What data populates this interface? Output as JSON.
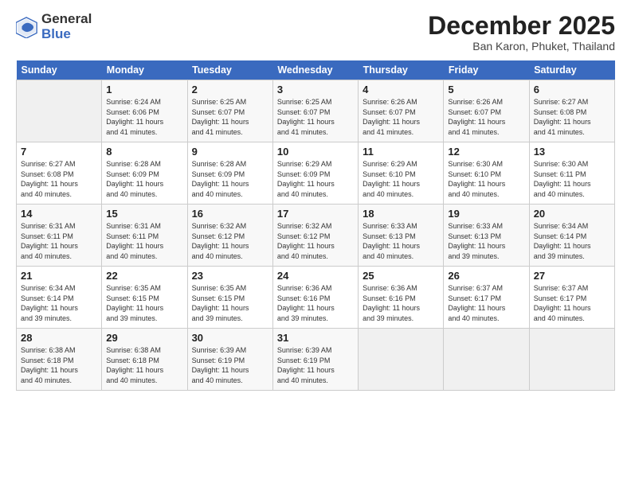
{
  "logo": {
    "general": "General",
    "blue": "Blue"
  },
  "header": {
    "month": "December 2025",
    "location": "Ban Karon, Phuket, Thailand"
  },
  "weekdays": [
    "Sunday",
    "Monday",
    "Tuesday",
    "Wednesday",
    "Thursday",
    "Friday",
    "Saturday"
  ],
  "weeks": [
    [
      {
        "day": "",
        "sunrise": "",
        "sunset": "",
        "daylight": ""
      },
      {
        "day": "1",
        "sunrise": "Sunrise: 6:24 AM",
        "sunset": "Sunset: 6:06 PM",
        "daylight": "Daylight: 11 hours and 41 minutes."
      },
      {
        "day": "2",
        "sunrise": "Sunrise: 6:25 AM",
        "sunset": "Sunset: 6:07 PM",
        "daylight": "Daylight: 11 hours and 41 minutes."
      },
      {
        "day": "3",
        "sunrise": "Sunrise: 6:25 AM",
        "sunset": "Sunset: 6:07 PM",
        "daylight": "Daylight: 11 hours and 41 minutes."
      },
      {
        "day": "4",
        "sunrise": "Sunrise: 6:26 AM",
        "sunset": "Sunset: 6:07 PM",
        "daylight": "Daylight: 11 hours and 41 minutes."
      },
      {
        "day": "5",
        "sunrise": "Sunrise: 6:26 AM",
        "sunset": "Sunset: 6:07 PM",
        "daylight": "Daylight: 11 hours and 41 minutes."
      },
      {
        "day": "6",
        "sunrise": "Sunrise: 6:27 AM",
        "sunset": "Sunset: 6:08 PM",
        "daylight": "Daylight: 11 hours and 41 minutes."
      }
    ],
    [
      {
        "day": "7",
        "sunrise": "Sunrise: 6:27 AM",
        "sunset": "Sunset: 6:08 PM",
        "daylight": "Daylight: 11 hours and 40 minutes."
      },
      {
        "day": "8",
        "sunrise": "Sunrise: 6:28 AM",
        "sunset": "Sunset: 6:09 PM",
        "daylight": "Daylight: 11 hours and 40 minutes."
      },
      {
        "day": "9",
        "sunrise": "Sunrise: 6:28 AM",
        "sunset": "Sunset: 6:09 PM",
        "daylight": "Daylight: 11 hours and 40 minutes."
      },
      {
        "day": "10",
        "sunrise": "Sunrise: 6:29 AM",
        "sunset": "Sunset: 6:09 PM",
        "daylight": "Daylight: 11 hours and 40 minutes."
      },
      {
        "day": "11",
        "sunrise": "Sunrise: 6:29 AM",
        "sunset": "Sunset: 6:10 PM",
        "daylight": "Daylight: 11 hours and 40 minutes."
      },
      {
        "day": "12",
        "sunrise": "Sunrise: 6:30 AM",
        "sunset": "Sunset: 6:10 PM",
        "daylight": "Daylight: 11 hours and 40 minutes."
      },
      {
        "day": "13",
        "sunrise": "Sunrise: 6:30 AM",
        "sunset": "Sunset: 6:11 PM",
        "daylight": "Daylight: 11 hours and 40 minutes."
      }
    ],
    [
      {
        "day": "14",
        "sunrise": "Sunrise: 6:31 AM",
        "sunset": "Sunset: 6:11 PM",
        "daylight": "Daylight: 11 hours and 40 minutes."
      },
      {
        "day": "15",
        "sunrise": "Sunrise: 6:31 AM",
        "sunset": "Sunset: 6:11 PM",
        "daylight": "Daylight: 11 hours and 40 minutes."
      },
      {
        "day": "16",
        "sunrise": "Sunrise: 6:32 AM",
        "sunset": "Sunset: 6:12 PM",
        "daylight": "Daylight: 11 hours and 40 minutes."
      },
      {
        "day": "17",
        "sunrise": "Sunrise: 6:32 AM",
        "sunset": "Sunset: 6:12 PM",
        "daylight": "Daylight: 11 hours and 40 minutes."
      },
      {
        "day": "18",
        "sunrise": "Sunrise: 6:33 AM",
        "sunset": "Sunset: 6:13 PM",
        "daylight": "Daylight: 11 hours and 40 minutes."
      },
      {
        "day": "19",
        "sunrise": "Sunrise: 6:33 AM",
        "sunset": "Sunset: 6:13 PM",
        "daylight": "Daylight: 11 hours and 39 minutes."
      },
      {
        "day": "20",
        "sunrise": "Sunrise: 6:34 AM",
        "sunset": "Sunset: 6:14 PM",
        "daylight": "Daylight: 11 hours and 39 minutes."
      }
    ],
    [
      {
        "day": "21",
        "sunrise": "Sunrise: 6:34 AM",
        "sunset": "Sunset: 6:14 PM",
        "daylight": "Daylight: 11 hours and 39 minutes."
      },
      {
        "day": "22",
        "sunrise": "Sunrise: 6:35 AM",
        "sunset": "Sunset: 6:15 PM",
        "daylight": "Daylight: 11 hours and 39 minutes."
      },
      {
        "day": "23",
        "sunrise": "Sunrise: 6:35 AM",
        "sunset": "Sunset: 6:15 PM",
        "daylight": "Daylight: 11 hours and 39 minutes."
      },
      {
        "day": "24",
        "sunrise": "Sunrise: 6:36 AM",
        "sunset": "Sunset: 6:16 PM",
        "daylight": "Daylight: 11 hours and 39 minutes."
      },
      {
        "day": "25",
        "sunrise": "Sunrise: 6:36 AM",
        "sunset": "Sunset: 6:16 PM",
        "daylight": "Daylight: 11 hours and 39 minutes."
      },
      {
        "day": "26",
        "sunrise": "Sunrise: 6:37 AM",
        "sunset": "Sunset: 6:17 PM",
        "daylight": "Daylight: 11 hours and 40 minutes."
      },
      {
        "day": "27",
        "sunrise": "Sunrise: 6:37 AM",
        "sunset": "Sunset: 6:17 PM",
        "daylight": "Daylight: 11 hours and 40 minutes."
      }
    ],
    [
      {
        "day": "28",
        "sunrise": "Sunrise: 6:38 AM",
        "sunset": "Sunset: 6:18 PM",
        "daylight": "Daylight: 11 hours and 40 minutes."
      },
      {
        "day": "29",
        "sunrise": "Sunrise: 6:38 AM",
        "sunset": "Sunset: 6:18 PM",
        "daylight": "Daylight: 11 hours and 40 minutes."
      },
      {
        "day": "30",
        "sunrise": "Sunrise: 6:39 AM",
        "sunset": "Sunset: 6:19 PM",
        "daylight": "Daylight: 11 hours and 40 minutes."
      },
      {
        "day": "31",
        "sunrise": "Sunrise: 6:39 AM",
        "sunset": "Sunset: 6:19 PM",
        "daylight": "Daylight: 11 hours and 40 minutes."
      },
      {
        "day": "",
        "sunrise": "",
        "sunset": "",
        "daylight": ""
      },
      {
        "day": "",
        "sunrise": "",
        "sunset": "",
        "daylight": ""
      },
      {
        "day": "",
        "sunrise": "",
        "sunset": "",
        "daylight": ""
      }
    ]
  ]
}
